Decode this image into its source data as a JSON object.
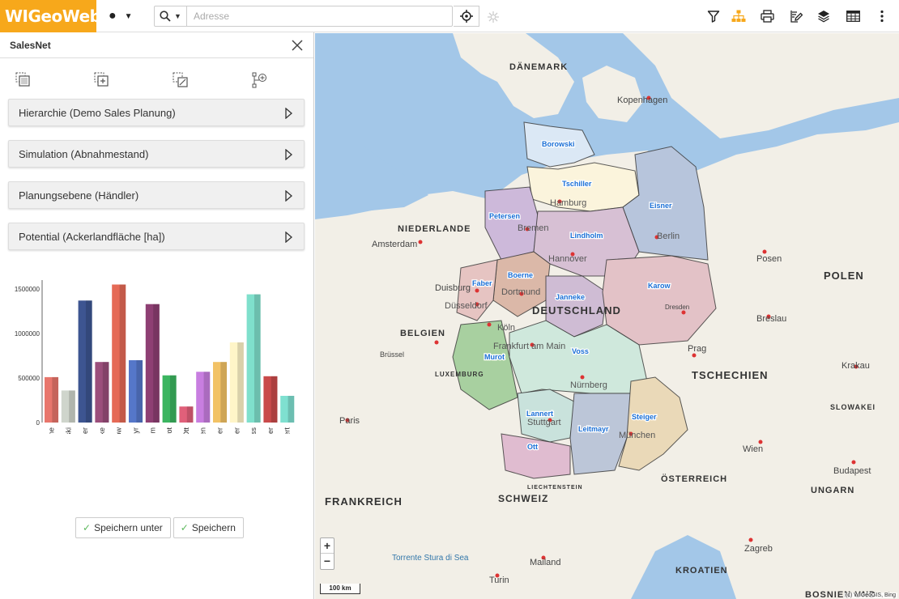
{
  "app": {
    "logo": "WIGeoWeb",
    "brand_color": "#f7a81b"
  },
  "toolbar": {
    "dot_menu": "●",
    "address_placeholder": "Adresse",
    "icons": [
      "filter-icon",
      "hierarchy-icon",
      "print-icon",
      "edit-icon",
      "layers-icon",
      "table-icon",
      "more-icon"
    ]
  },
  "panel": {
    "title": "SalesNet",
    "accordions": [
      {
        "label": "Hierarchie (Demo Sales Planung)"
      },
      {
        "label": "Simulation (Abnahmestand)"
      },
      {
        "label": "Planungsebene (Händler)"
      },
      {
        "label": "Potential (Ackerlandfläche [ha])"
      }
    ],
    "buttons": {
      "save_as": "Speichern unter",
      "save": "Speichern"
    }
  },
  "chart_data": {
    "type": "bar",
    "categories": [
      "Boerne",
      "Borowski",
      "Eisner",
      "Janneke",
      "Karow",
      "Leitmayr",
      "Lindholm",
      "Murot",
      "Ott",
      "Petersen",
      "Steiger",
      "Tschiller",
      "Voss",
      "Faber",
      "Lannert"
    ],
    "values": [
      510000,
      360000,
      1370000,
      680000,
      1550000,
      700000,
      1330000,
      530000,
      180000,
      570000,
      680000,
      900000,
      1440000,
      520000,
      300000
    ],
    "colors": [
      "#e8766c",
      "#cfd5cc",
      "#3d5591",
      "#9b4e7b",
      "#e56a56",
      "#5577c9",
      "#8e3f73",
      "#3bb560",
      "#e0607a",
      "#c87ee0",
      "#f2c266",
      "#fff5c8",
      "#7fe0cc",
      "#c94a4a",
      "#7fe0d0"
    ],
    "yticks": [
      "1500000",
      "1000000",
      "500000",
      "0"
    ],
    "ylim": [
      0,
      1600000
    ]
  },
  "map": {
    "countries": [
      "DÄNEMARK",
      "NIEDERLANDE",
      "DEUTSCHLAND",
      "BELGIEN",
      "LUXEMBURG",
      "FRANKREICH",
      "SCHWEIZ",
      "LIECHTENSTEIN",
      "ÖSTERREICH",
      "TSCHECHIEN",
      "POLEN",
      "SLOWAKEI",
      "UNGARN",
      "KROATIEN",
      "BOSNIEN UND"
    ],
    "cities": [
      "Kopenhagen",
      "Hamburg",
      "Bremen",
      "Hannover",
      "Berlin",
      "Amsterdam",
      "Dortmund",
      "Düsseldorf",
      "Köln",
      "Frankfurt am Main",
      "Nürnberg",
      "Stuttgart",
      "München",
      "Prag",
      "Wien",
      "Paris",
      "Posen",
      "Breslau",
      "Krakau",
      "Budapest",
      "Zagreb",
      "Mailand",
      "Turin",
      "Dresden",
      "Brüssel",
      "Duisburg"
    ],
    "territories": [
      "Borowski",
      "Tschiller",
      "Eisner",
      "Petersen",
      "Lindholm",
      "Boerne",
      "Faber",
      "Janneke",
      "Karow",
      "Murot",
      "Voss",
      "Lannert",
      "Leitmayr",
      "Steiger",
      "Ott"
    ],
    "scale": "100 km",
    "attribution": "(c) WIGeoGIS, Bing",
    "zoom_in": "+",
    "zoom_out": "−",
    "sea_label": "Torrente Stura di Sea"
  }
}
